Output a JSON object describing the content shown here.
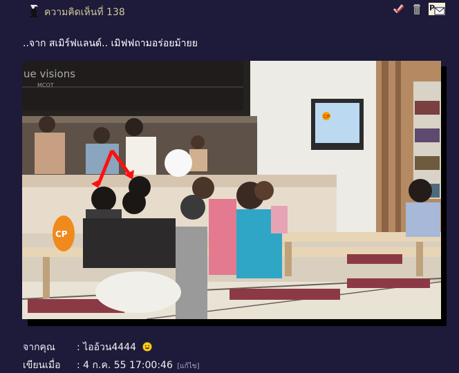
{
  "header": {
    "comment_number": "ความคิดเห็นที่ 138",
    "icons": [
      "avatar-icon",
      "check-icon",
      "trash-icon",
      "message-icon"
    ]
  },
  "comment": {
    "text": "..จาก สเมิร์ฟแลนด์.. เมิฟฟถามอร่อยม้ายย"
  },
  "video": {
    "watermark": "ue visions",
    "watermark_sub": "MCOT",
    "tv_logo": "CP",
    "cushion_logo": "CP"
  },
  "footer": {
    "from_label": "จากคุณ",
    "from_value": ": ไออ้วน4444",
    "written_label": "เขียนเมื่อ",
    "written_value": ": 4 ก.ค. 55 17:00:46",
    "edit_label": "[แก้ไข]"
  },
  "colors": {
    "background": "#1d1a3a",
    "header_text": "#d4c89a",
    "arrow": "#ff1010"
  }
}
